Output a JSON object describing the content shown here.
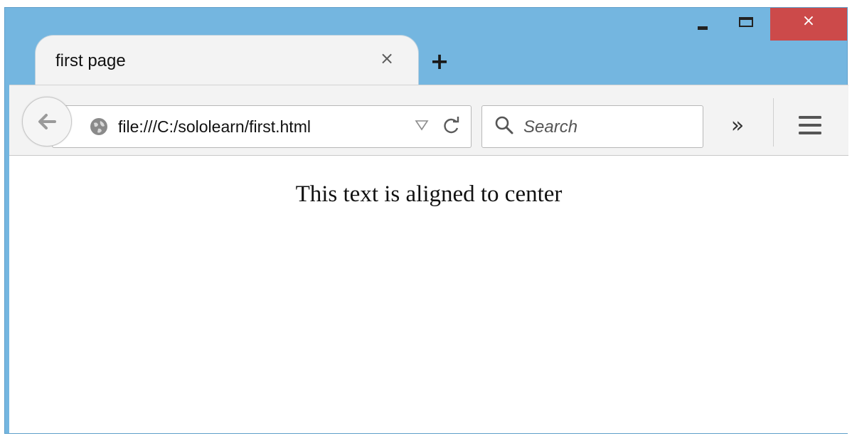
{
  "window": {
    "controls": {
      "minimize_icon": "minimize-icon",
      "maximize_icon": "maximize-icon",
      "close_glyph": "×",
      "close_color": "#cc4a4a"
    },
    "frame_color": "#74b6e0"
  },
  "tabs": [
    {
      "title": "first page",
      "close_glyph": "×"
    }
  ],
  "new_tab_glyph": "+",
  "toolbar": {
    "back_icon": "back-arrow-icon",
    "url": "file:///C:/sololearn/first.html",
    "site_icon": "globe-icon",
    "dropdown_icon": "dropdown-triangle-icon",
    "reload_icon": "reload-icon",
    "search": {
      "placeholder": "Search",
      "icon": "search-icon"
    },
    "overflow_glyph": "»",
    "menu_icon": "hamburger-menu-icon"
  },
  "page": {
    "text": "This text is aligned to center"
  }
}
